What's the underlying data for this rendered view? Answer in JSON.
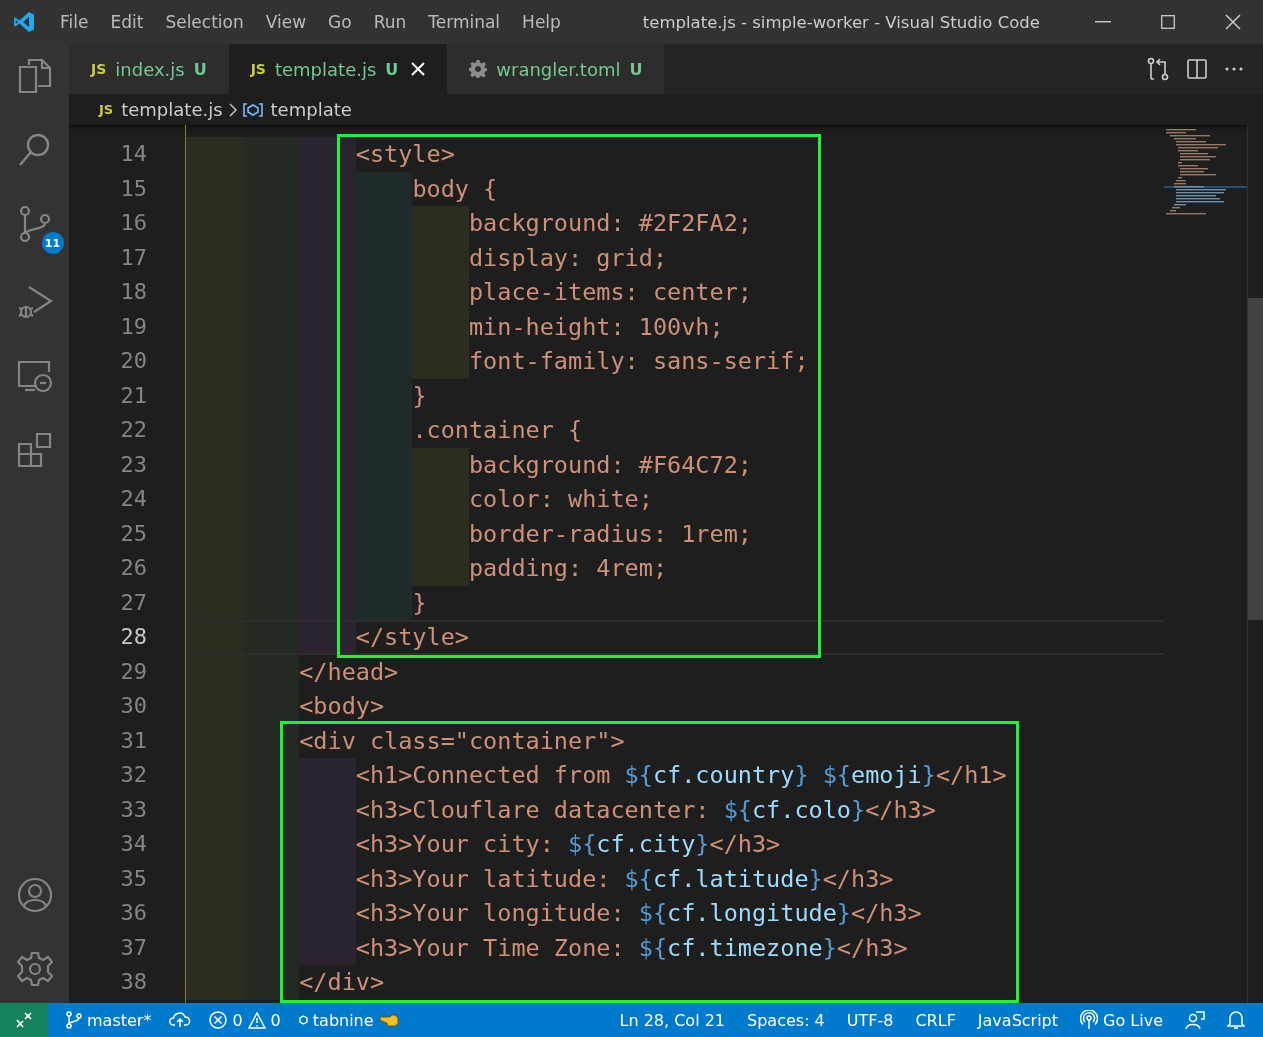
{
  "window": {
    "title": "template.js - simple-worker - Visual Studio Code"
  },
  "menu": [
    "File",
    "Edit",
    "Selection",
    "View",
    "Go",
    "Run",
    "Terminal",
    "Help"
  ],
  "activity": [
    {
      "kind": "explorer"
    },
    {
      "kind": "search"
    },
    {
      "kind": "scm",
      "badge": "11"
    },
    {
      "kind": "debug"
    },
    {
      "kind": "remote"
    },
    {
      "kind": "extensions"
    }
  ],
  "activity_bottom": [
    {
      "kind": "account"
    },
    {
      "kind": "settings"
    }
  ],
  "tabs": [
    {
      "kind": "js",
      "icon_text": "JS",
      "label": "index.js",
      "status": "U",
      "selected": false
    },
    {
      "kind": "js",
      "icon_text": "JS",
      "label": "template.js",
      "status": "U",
      "selected": true
    },
    {
      "kind": "config",
      "label": "wrangler.toml",
      "status": "U",
      "selected": false
    }
  ],
  "breadcrumb": [
    {
      "kind": "file",
      "icon_text": "JS",
      "label": "template.js"
    },
    {
      "kind": "symbol",
      "label": "template"
    }
  ],
  "blocks": [
    {
      "boxed": true,
      "lines": [
        {
          "number": "14",
          "current": false,
          "tokens": [
            {
              "kind": "str",
              "t": "            <style>"
            }
          ]
        },
        {
          "number": "15",
          "current": false,
          "tokens": [
            {
              "kind": "str",
              "t": "                body {"
            }
          ]
        },
        {
          "number": "16",
          "current": false,
          "tokens": [
            {
              "kind": "str",
              "t": "                    background: #2F2FA2;"
            }
          ]
        },
        {
          "number": "17",
          "current": false,
          "tokens": [
            {
              "kind": "str",
              "t": "                    display: grid;"
            }
          ]
        },
        {
          "number": "18",
          "current": false,
          "tokens": [
            {
              "kind": "str",
              "t": "                    place-items: center;"
            }
          ]
        },
        {
          "number": "19",
          "current": false,
          "tokens": [
            {
              "kind": "str",
              "t": "                    min-height: 100vh;"
            }
          ]
        },
        {
          "number": "20",
          "current": false,
          "tokens": [
            {
              "kind": "str",
              "t": "                    font-family: sans-serif;"
            }
          ]
        },
        {
          "number": "21",
          "current": false,
          "tokens": [
            {
              "kind": "str",
              "t": "                }"
            }
          ]
        },
        {
          "number": "22",
          "current": false,
          "tokens": [
            {
              "kind": "str",
              "t": "                .container {"
            }
          ]
        },
        {
          "number": "23",
          "current": false,
          "tokens": [
            {
              "kind": "str",
              "t": "                    background: #F64C72;"
            }
          ]
        },
        {
          "number": "24",
          "current": false,
          "tokens": [
            {
              "kind": "str",
              "t": "                    color: white;"
            }
          ]
        },
        {
          "number": "25",
          "current": false,
          "tokens": [
            {
              "kind": "str",
              "t": "                    border-radius: 1rem;"
            }
          ]
        },
        {
          "number": "26",
          "current": false,
          "tokens": [
            {
              "kind": "str",
              "t": "                    padding: 4rem;"
            }
          ]
        },
        {
          "number": "27",
          "current": false,
          "tokens": [
            {
              "kind": "str",
              "t": "                }"
            }
          ]
        },
        {
          "number": "28",
          "current": true,
          "tokens": [
            {
              "kind": "str",
              "t": "            </style>"
            }
          ]
        }
      ]
    },
    {
      "boxed": false,
      "lines": [
        {
          "number": "29",
          "current": false,
          "tokens": [
            {
              "kind": "str",
              "t": "        </head>"
            }
          ]
        },
        {
          "number": "30",
          "current": false,
          "tokens": [
            {
              "kind": "str",
              "t": "        <body>"
            }
          ]
        }
      ]
    },
    {
      "boxed": true,
      "lines": [
        {
          "number": "31",
          "current": false,
          "tokens": [
            {
              "kind": "str",
              "t": "        <div class=\"container\">"
            }
          ]
        },
        {
          "number": "32",
          "current": false,
          "tokens": [
            {
              "kind": "str",
              "t": "            <h1>Connected from "
            },
            {
              "kind": "punct",
              "t": "${"
            },
            {
              "kind": "var",
              "t": "cf.country"
            },
            {
              "kind": "punct",
              "t": "}"
            },
            {
              "kind": "punct",
              "t": " ${"
            },
            {
              "kind": "var",
              "t": "emoji"
            },
            {
              "kind": "punct",
              "t": "}"
            },
            {
              "kind": "str",
              "t": "</h1>"
            }
          ]
        },
        {
          "number": "33",
          "current": false,
          "tokens": [
            {
              "kind": "str",
              "t": "            <h3>Clouflare datacenter: "
            },
            {
              "kind": "punct",
              "t": "${"
            },
            {
              "kind": "var",
              "t": "cf.colo"
            },
            {
              "kind": "punct",
              "t": "}"
            },
            {
              "kind": "str",
              "t": "</h3>"
            }
          ]
        },
        {
          "number": "34",
          "current": false,
          "tokens": [
            {
              "kind": "str",
              "t": "            <h3>Your city: "
            },
            {
              "kind": "punct",
              "t": "${"
            },
            {
              "kind": "var",
              "t": "cf.city"
            },
            {
              "kind": "punct",
              "t": "}"
            },
            {
              "kind": "str",
              "t": "</h3>"
            }
          ]
        },
        {
          "number": "35",
          "current": false,
          "tokens": [
            {
              "kind": "str",
              "t": "            <h3>Your latitude: "
            },
            {
              "kind": "punct",
              "t": "${"
            },
            {
              "kind": "var",
              "t": "cf.latitude"
            },
            {
              "kind": "punct",
              "t": "}"
            },
            {
              "kind": "str",
              "t": "</h3>"
            }
          ]
        },
        {
          "number": "36",
          "current": false,
          "tokens": [
            {
              "kind": "str",
              "t": "            <h3>Your longitude: "
            },
            {
              "kind": "punct",
              "t": "${"
            },
            {
              "kind": "var",
              "t": "cf.longitude"
            },
            {
              "kind": "punct",
              "t": "}"
            },
            {
              "kind": "str",
              "t": "</h3>"
            }
          ]
        },
        {
          "number": "37",
          "current": false,
          "tokens": [
            {
              "kind": "str",
              "t": "            <h3>Your Time Zone: "
            },
            {
              "kind": "punct",
              "t": "${"
            },
            {
              "kind": "var",
              "t": "cf.timezone"
            },
            {
              "kind": "punct",
              "t": "}"
            },
            {
              "kind": "str",
              "t": "</h3>"
            }
          ]
        },
        {
          "number": "38",
          "current": false,
          "tokens": [
            {
              "kind": "str",
              "t": "        </div>"
            }
          ]
        }
      ]
    }
  ],
  "status_left": [
    {
      "kind": "remote"
    },
    {
      "kind": "branch",
      "label": "master*"
    },
    {
      "kind": "sync"
    },
    {
      "kind": "problems",
      "errors": "0",
      "warnings": "0"
    },
    {
      "kind": "tabnine",
      "label": "tabnine"
    }
  ],
  "status_right": [
    {
      "kind": "text",
      "label": "Ln 28, Col 21"
    },
    {
      "kind": "text",
      "label": "Spaces: 4"
    },
    {
      "kind": "text",
      "label": "UTF-8"
    },
    {
      "kind": "text",
      "label": "CRLF"
    },
    {
      "kind": "text",
      "label": "JavaScript"
    },
    {
      "kind": "golive",
      "label": "Go Live"
    },
    {
      "kind": "feedback"
    },
    {
      "kind": "bell"
    }
  ]
}
